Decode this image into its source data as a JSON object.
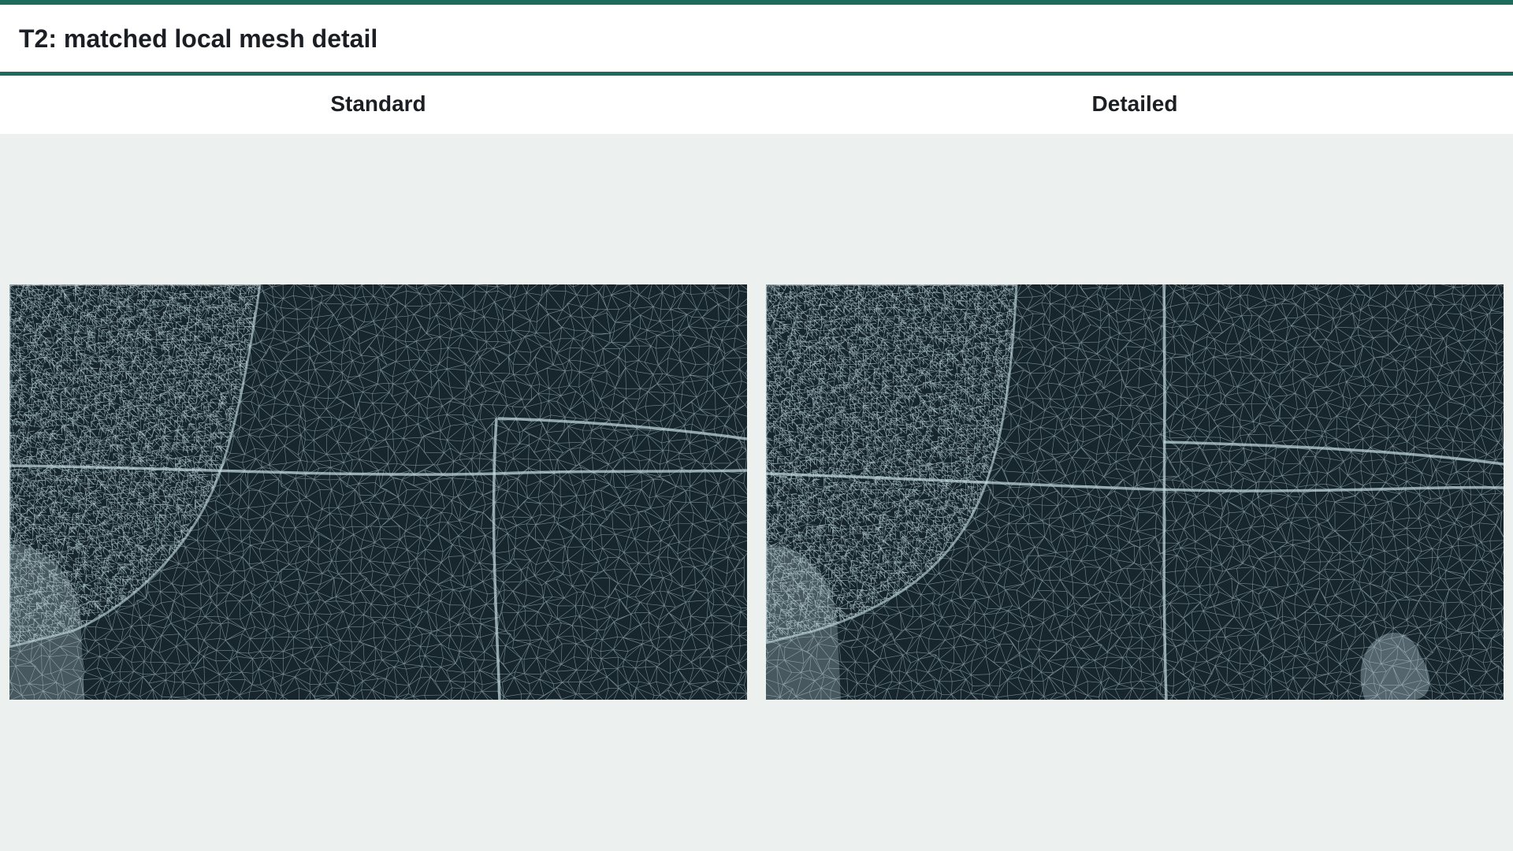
{
  "page": {
    "title": "T2: matched local mesh detail"
  },
  "colors": {
    "accent": "#1d6b5a",
    "panel_background": "#ecf0ef",
    "mesh_background": "#17262d",
    "mesh_line": "#c7dde4"
  },
  "comparison": {
    "left_label": "Standard",
    "right_label": "Detailed"
  },
  "panels": [
    {
      "name": "standard-mesh-view",
      "description_icon": "wireframe-mesh"
    },
    {
      "name": "detailed-mesh-view",
      "description_icon": "wireframe-mesh"
    }
  ]
}
